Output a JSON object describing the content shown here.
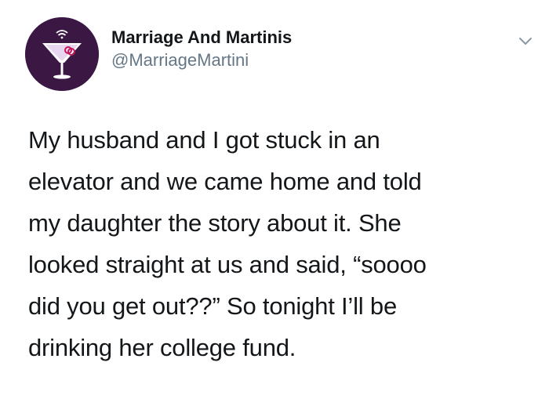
{
  "tweet": {
    "author": {
      "display_name": "Marriage And Martinis",
      "handle": "@MarriageMartini",
      "avatar_icon": "martini-glass-icon",
      "avatar_color": "#3b1744"
    },
    "menu_icon": "chevron-down-icon",
    "text_lines": [
      "My husband and I got stuck in an",
      "elevator and we came home and told",
      "my daughter the story about it. She",
      "looked straight at us and said, “soooo",
      "did you get out??” So tonight I’ll be",
      "drinking her college fund."
    ]
  }
}
